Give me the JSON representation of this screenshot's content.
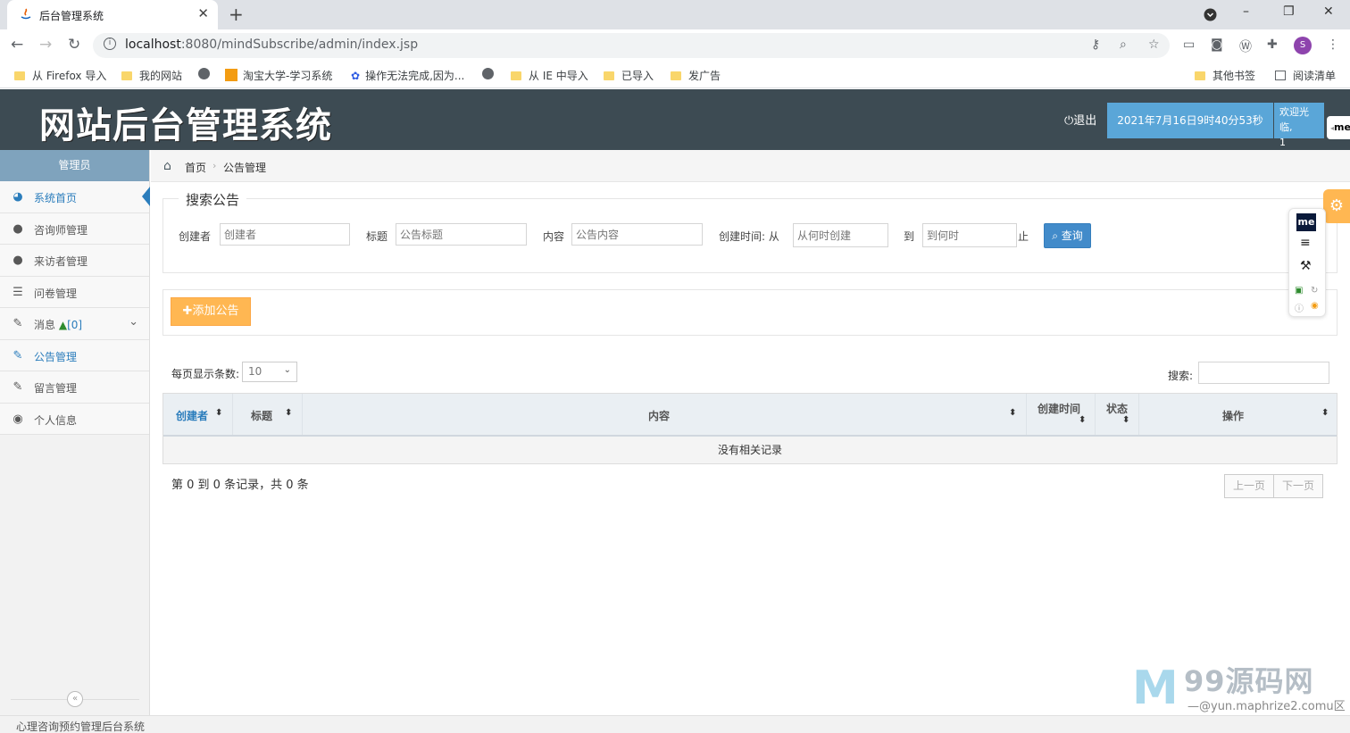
{
  "browser": {
    "tab_title": "后台管理系统",
    "tab_close": "✕",
    "new_tab": "+",
    "url_host": "localhost",
    "url_rest": ":8080/mindSubscribe/admin/index.jsp",
    "profile_initial": "S",
    "window_controls": [
      "–",
      "❐",
      "✕"
    ],
    "bookmarks": [
      {
        "label": "从 Firefox 导入",
        "icon": "folder-icon"
      },
      {
        "label": "我的网站",
        "icon": "folder-icon"
      },
      {
        "label": "",
        "icon": "globe-icon"
      },
      {
        "label": "淘宝大学-学习系统",
        "icon": "taobao-icon"
      },
      {
        "label": "操作无法完成,因为...",
        "icon": "baidu-paw-icon"
      },
      {
        "label": "",
        "icon": "globe-icon"
      },
      {
        "label": "从 IE 中导入",
        "icon": "folder-icon"
      },
      {
        "label": "已导入",
        "icon": "folder-icon"
      },
      {
        "label": "发广告",
        "icon": "folder-icon"
      }
    ],
    "bookmarks_right": [
      {
        "label": "其他书签",
        "icon": "folder-icon"
      },
      {
        "label": "阅读清单",
        "icon": "reading-list-icon"
      }
    ]
  },
  "header": {
    "logo": "网站后台管理系统",
    "logout": "退出",
    "datetime": "2021年7月16日9时40分53秒",
    "welcome_line1": "欢迎光临,",
    "welcome_line2": "1",
    "side_tab": "me"
  },
  "sidebar": {
    "title": "管理员",
    "items": [
      {
        "label": "系统首页",
        "icon": "dashboard-icon",
        "active": true
      },
      {
        "label": "咨询师管理",
        "icon": "user-icon"
      },
      {
        "label": "来访者管理",
        "icon": "user-icon"
      },
      {
        "label": "问卷管理",
        "icon": "list-icon"
      },
      {
        "label": "消息",
        "badge": "[0]",
        "icon": "edit-icon",
        "has_children": true
      },
      {
        "label": "公告管理",
        "icon": "edit-icon",
        "active_text": true
      },
      {
        "label": "留言管理",
        "icon": "edit-icon"
      },
      {
        "label": "个人信息",
        "icon": "users-icon"
      }
    ],
    "collapse": "«"
  },
  "breadcrumb": {
    "home": "首页",
    "current": "公告管理"
  },
  "search": {
    "legend": "搜索公告",
    "creator_label": "创建者",
    "creator_placeholder": "创建者",
    "title_label": "标题",
    "title_placeholder": "公告标题",
    "content_label": "内容",
    "content_placeholder": "公告内容",
    "time_label": "创建时间: 从",
    "time_from_placeholder": "从何时创建",
    "time_to_label": "到",
    "time_to_placeholder": "到何时",
    "time_end_label": "止",
    "query_button": "查询"
  },
  "toolbar": {
    "add_button": "添加公告"
  },
  "table_controls": {
    "page_size_label": "每页显示条数:",
    "page_size_value": "10",
    "search_label": "搜索:"
  },
  "table": {
    "columns": [
      "创建者",
      "标题",
      "内容",
      "创建时间",
      "状态",
      "操作"
    ],
    "empty_text": "没有相关记录"
  },
  "pagination": {
    "info": "第 0 到 0 条记录，共 0 条",
    "prev": "上一页",
    "next": "下一页"
  },
  "float_tools": {
    "me": "me"
  },
  "watermark": {
    "logo_letter": "M",
    "text": "99源码网",
    "url": "—@yun.maphrize2.comu区"
  },
  "footer": {
    "text": "心理咨询预约管理后台系统"
  },
  "colors": {
    "header_bg": "#3d4b53",
    "accent_blue": "#2b7dbc",
    "clock_bg": "#5aa6d8",
    "add_button": "#ffb752",
    "query_button": "#428bca"
  }
}
